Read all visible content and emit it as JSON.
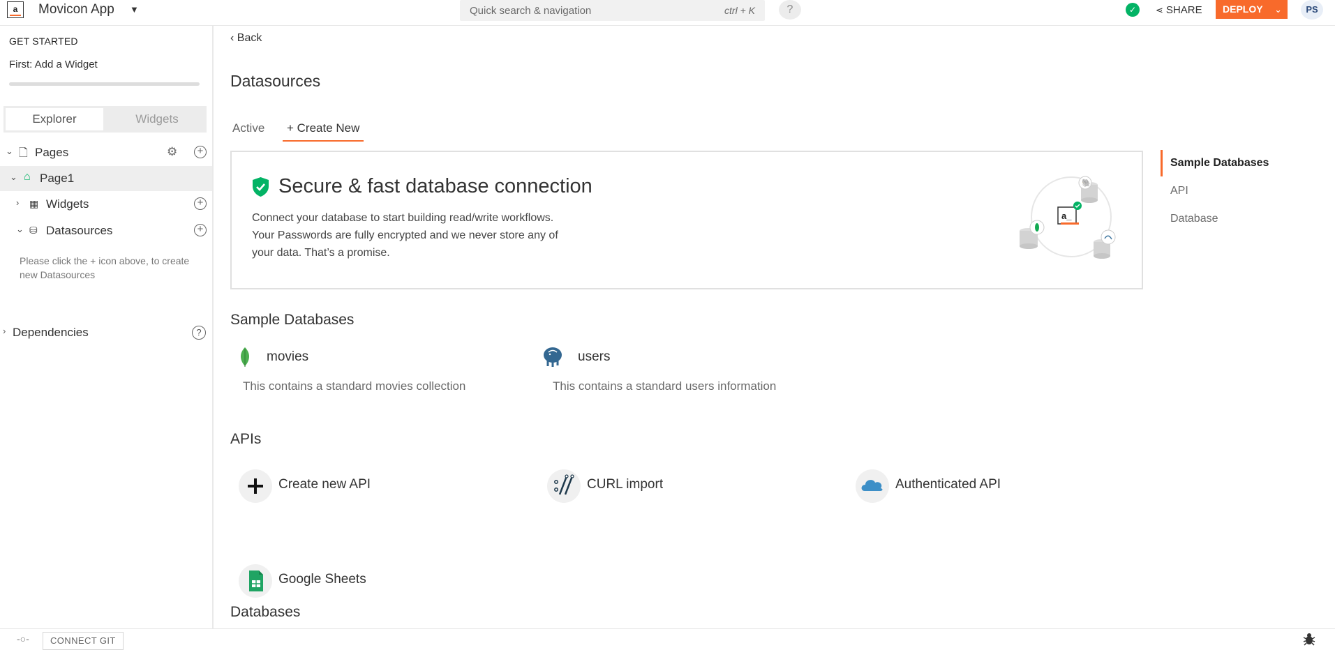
{
  "header": {
    "app_name": "Movicon App",
    "search_placeholder": "Quick search & navigation",
    "search_shortcut": "ctrl + K",
    "help": "?",
    "share_label": "SHARE",
    "deploy_label": "DEPLOY",
    "avatar_initials": "PS",
    "colors": {
      "accent": "#f86a2b",
      "status_ok": "#03b365"
    }
  },
  "sidebar": {
    "get_started_title": "GET STARTED",
    "get_started_step": "First: Add a Widget",
    "tabs": [
      "Explorer",
      "Widgets"
    ],
    "tree": {
      "pages": "Pages",
      "page1": "Page1",
      "widgets": "Widgets",
      "datasources": "Datasources"
    },
    "datasources_hint": "Please click the + icon above, to create new Datasources",
    "dependencies": "Dependencies"
  },
  "main": {
    "back_label": "Back",
    "page_title": "Datasources",
    "tabs": {
      "active": "Active",
      "create_new": "Create New"
    },
    "banner": {
      "title": "Secure & fast database connection",
      "description": "Connect your database to start building read/write workflows. Your Passwords are fully encrypted and we never store any of your data. That’s a promise."
    },
    "sample_databases": {
      "title": "Sample Databases",
      "items": [
        {
          "name": "movies",
          "description": "This contains a standard movies collection",
          "icon": "mongodb-leaf-icon"
        },
        {
          "name": "users",
          "description": "This contains a standard users information",
          "icon": "postgres-elephant-icon"
        }
      ]
    },
    "apis": {
      "title": "APIs",
      "items": [
        {
          "label": "Create new API",
          "icon": "plus-icon"
        },
        {
          "label": "CURL import",
          "icon": "curl-icon"
        },
        {
          "label": "Authenticated API",
          "icon": "cloud-icon"
        },
        {
          "label": "Google Sheets",
          "icon": "google-sheets-icon"
        }
      ]
    },
    "databases_title": "Databases",
    "right_nav": [
      "Sample Databases",
      "API",
      "Database"
    ]
  },
  "footer": {
    "connect_git": "CONNECT GIT"
  }
}
